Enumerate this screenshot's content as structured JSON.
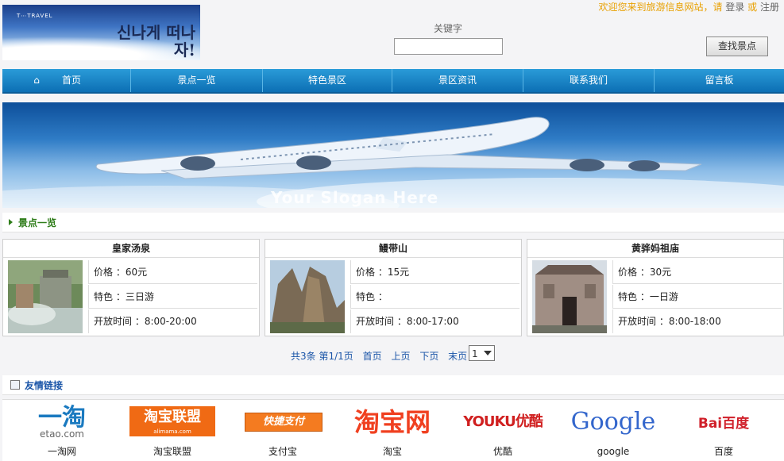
{
  "header": {
    "logo_brand": "T⋯TRAVEL",
    "logo_script": "신나게 떠나자!",
    "welcome": "欢迎您来到旅游信息网站，请",
    "login": "登录",
    "or": "或",
    "register": "注册",
    "keyword_label": "关键字",
    "keyword_value": "",
    "search_button": "查找景点"
  },
  "nav": [
    "首页",
    "景点一览",
    "特色景区",
    "景区资讯",
    "联系我们",
    "留言板"
  ],
  "banner": {
    "slogan": "Your Slogan Here"
  },
  "section_scenic": "景点一览",
  "spots": [
    {
      "name": "皇家汤泉",
      "price_label": "价格",
      "price": "60元",
      "feature_label": "特色",
      "feature": "三日游",
      "hours_label": "开放时间",
      "hours": "8:00-20:00"
    },
    {
      "name": "鳗带山",
      "price_label": "价格",
      "price": "15元",
      "feature_label": "特色",
      "feature": "",
      "hours_label": "开放时间",
      "hours": "8:00-17:00"
    },
    {
      "name": "黄骅妈祖庙",
      "price_label": "价格",
      "price": "30元",
      "feature_label": "特色",
      "feature": "一日游",
      "hours_label": "开放时间",
      "hours": "8:00-18:00"
    }
  ],
  "pager": {
    "total": "共3条",
    "page_info": "第1/1页",
    "first": "首页",
    "prev": "上页",
    "next": "下页",
    "last": "末页",
    "selected": "1"
  },
  "section_links": "友情链接",
  "links": [
    {
      "logo_text": "一淘",
      "logo_sub": "etao.com",
      "caption": "一淘网"
    },
    {
      "logo_text": "淘宝联盟",
      "logo_sub": "alimama.com",
      "caption": "淘宝联盟"
    },
    {
      "logo_text": "快捷支付",
      "logo_sub": "",
      "caption": "支付宝"
    },
    {
      "logo_text": "淘宝网",
      "logo_sub": "",
      "caption": "淘宝"
    },
    {
      "logo_text": "YOUKU优酷",
      "logo_sub": "",
      "caption": "优酷"
    },
    {
      "logo_text": "Google",
      "logo_sub": "",
      "caption": "google"
    },
    {
      "logo_text": "Bai百度",
      "logo_sub": "",
      "caption": "百度"
    }
  ],
  "colors": {
    "nav_blue": "#0c6fb4",
    "section_green": "#2f7d1a",
    "link_blue": "#1a55a8",
    "welcome_orange": "#e8a000"
  }
}
